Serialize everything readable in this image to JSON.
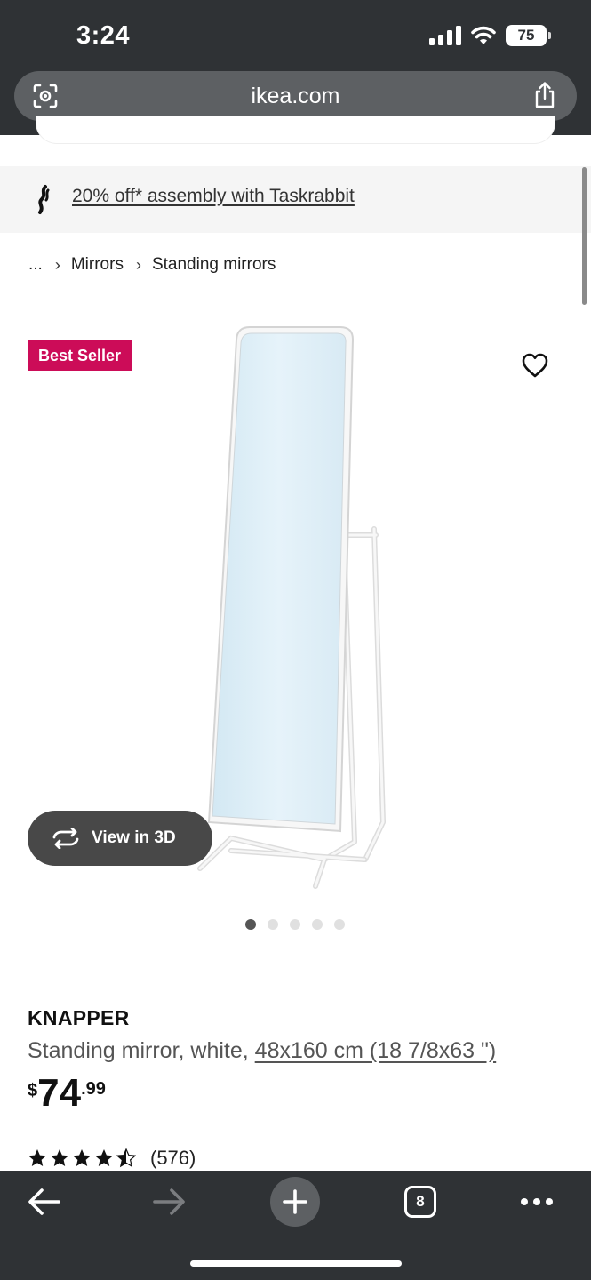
{
  "status_bar": {
    "time": "3:24",
    "battery": "75",
    "icons": [
      "signal-icon",
      "wifi-icon",
      "battery-icon"
    ]
  },
  "browser": {
    "url": "ikea.com",
    "lens_icon": "camera-search-icon",
    "share_icon": "share-icon"
  },
  "banner": {
    "icon": "taskrabbit-icon",
    "text": "20% off* assembly with Taskrabbit"
  },
  "breadcrumb": {
    "items": [
      "...",
      "Mirrors",
      "Standing mirrors"
    ]
  },
  "product": {
    "badge": "Best Seller",
    "badge_color": "#cc0c58",
    "favorite_icon": "heart-icon",
    "view3d_label": "View in 3D",
    "gallery": {
      "count": 5,
      "active_index": 0
    },
    "name": "KNAPPER",
    "desc_prefix": "Standing mirror, white, ",
    "desc_size": "48x160 cm (18 7/8x63 \")",
    "price_currency": "$",
    "price_main": "74",
    "price_cents": ".99",
    "rating_value": 4.5,
    "rating_count": "(576)"
  },
  "toolbar": {
    "tabs_count": "8",
    "icons": [
      "back-arrow-icon",
      "forward-arrow-icon",
      "new-tab-plus-icon",
      "tabs-icon",
      "more-icon"
    ]
  }
}
